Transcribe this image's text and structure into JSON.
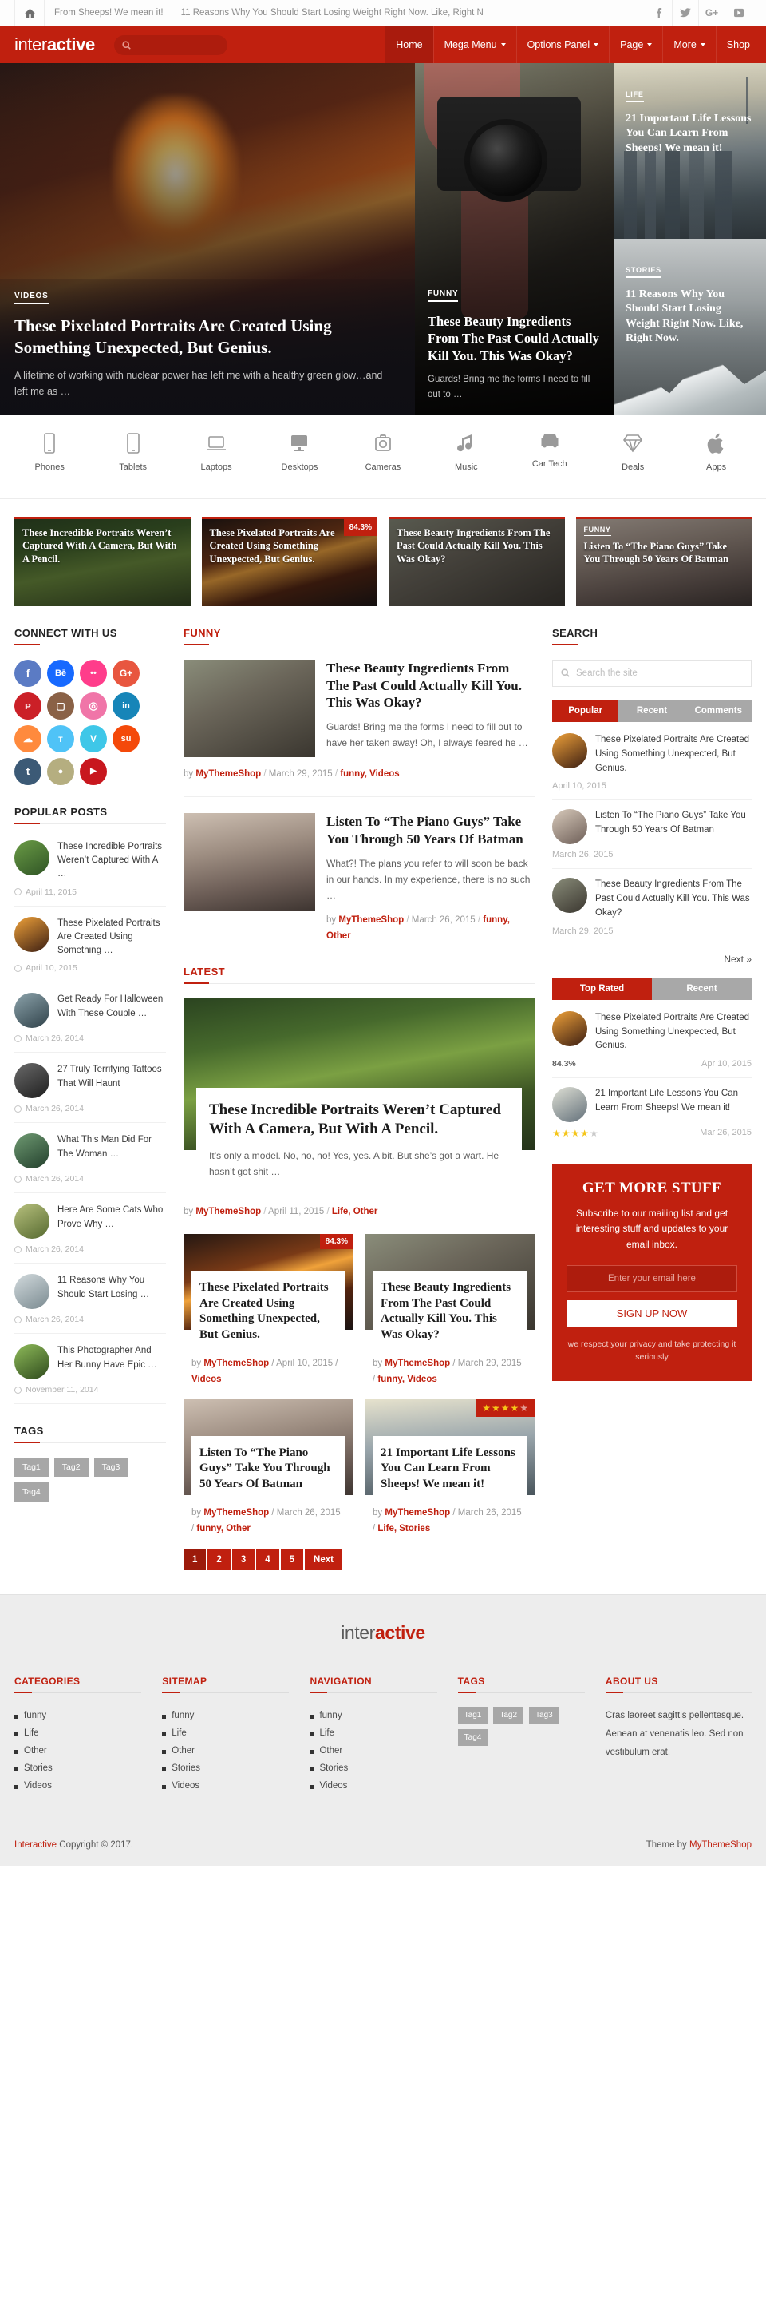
{
  "topbar": {
    "home_icon": "home-icon",
    "ticker": [
      "From Sheeps! We mean it!",
      "11 Reasons Why You Should Start Losing Weight Right Now. Like, Right N"
    ],
    "social": [
      "f",
      "𝐓",
      "G+",
      "▶"
    ]
  },
  "nav": {
    "logo_light": "inter",
    "logo_bold": "active",
    "search_placeholder": "",
    "items": [
      {
        "label": "Home",
        "caret": false,
        "active": true
      },
      {
        "label": "Mega Menu",
        "caret": true,
        "active": false
      },
      {
        "label": "Options Panel",
        "caret": true,
        "active": false
      },
      {
        "label": "Page",
        "caret": true,
        "active": false
      },
      {
        "label": "More",
        "caret": true,
        "active": false
      },
      {
        "label": "Shop",
        "caret": false,
        "active": false
      }
    ]
  },
  "hero": {
    "main": {
      "category": "VIDEOS",
      "title": "These Pixelated Portraits Are Created Using Something Unexpected, But Genius.",
      "excerpt": "A lifetime of working with nuclear power has left me with a healthy green glow…and left me as …"
    },
    "mid": {
      "category": "FUNNY",
      "title": "These Beauty Ingredients From The Past Could Actually Kill You. This Was Okay?",
      "excerpt": "Guards! Bring me the forms I need to fill out to …"
    },
    "right": [
      {
        "category": "LIFE",
        "title": "21 Important Life Lessons You Can Learn From Sheeps! We mean it!"
      },
      {
        "category": "STORIES",
        "title": "11 Reasons Why You Should Start Losing Weight Right Now. Like, Right Now."
      }
    ]
  },
  "categories": [
    {
      "label": "Phones",
      "icon": "phone-icon"
    },
    {
      "label": "Tablets",
      "icon": "tablet-icon"
    },
    {
      "label": "Laptops",
      "icon": "laptop-icon"
    },
    {
      "label": "Desktops",
      "icon": "desktop-icon"
    },
    {
      "label": "Cameras",
      "icon": "camera-icon"
    },
    {
      "label": "Music",
      "icon": "music-note-icon"
    },
    {
      "label": "Car Tech",
      "icon": "car-icon"
    },
    {
      "label": "Deals",
      "icon": "diamond-icon"
    },
    {
      "label": "Apps",
      "icon": "apple-icon"
    }
  ],
  "feature_cards": [
    {
      "title": "These Incredible Portraits Weren’t Captured With A Camera, But With A Pencil.",
      "badge": "",
      "tag": "",
      "bg": "bg-forest"
    },
    {
      "title": "These Pixelated Portraits Are Created Using Something Unexpected, But Genius.",
      "badge": "84.3%",
      "tag": "",
      "bg": "bg-fire"
    },
    {
      "title": "These Beauty Ingredients From The Past Could Actually Kill You. This Was Okay?",
      "badge": "",
      "tag": "",
      "bg": "bg-cam"
    },
    {
      "title": "Listen To “The Piano Guys” Take You Through 50 Years Of Batman",
      "badge": "",
      "tag": "FUNNY",
      "bg": "bg-desk"
    }
  ],
  "left": {
    "connect_title": "CONNECT WITH US",
    "social": [
      {
        "name": "facebook",
        "glyph": "f",
        "color": "#5b7bc4"
      },
      {
        "name": "behance",
        "glyph": "Bē",
        "color": "#1769ff"
      },
      {
        "name": "flickr",
        "glyph": "••",
        "color": "#ff3d8b"
      },
      {
        "name": "google-plus",
        "glyph": "G+",
        "color": "#e8563f"
      },
      {
        "name": "pinterest",
        "glyph": "ᴘ",
        "color": "#cb2027"
      },
      {
        "name": "instagram",
        "glyph": "▢",
        "color": "#8a6146"
      },
      {
        "name": "dribbble",
        "glyph": "◎",
        "color": "#f075a8"
      },
      {
        "name": "linkedin",
        "glyph": "in",
        "color": "#1685b8"
      },
      {
        "name": "soundcloud",
        "glyph": "☁",
        "color": "#ff8a3d"
      },
      {
        "name": "twitter",
        "glyph": "ᴛ",
        "color": "#4fc3f7"
      },
      {
        "name": "vimeo",
        "glyph": "V",
        "color": "#3ec7e8"
      },
      {
        "name": "stumbleupon",
        "glyph": "su",
        "color": "#f4490a"
      },
      {
        "name": "tumblr",
        "glyph": "t",
        "color": "#3c5a76"
      },
      {
        "name": "github",
        "glyph": "●",
        "color": "#b5ae80"
      },
      {
        "name": "youtube",
        "glyph": "▶",
        "color": "#c8171e"
      }
    ],
    "popular_title": "POPULAR POSTS",
    "popular": [
      {
        "title": "These Incredible Portraits Weren’t Captured With A …",
        "date": "April 11, 2015",
        "color": "#4e7a33"
      },
      {
        "title": "These Pixelated Portraits Are Created Using Something …",
        "date": "April 10, 2015",
        "color": "#63321a"
      },
      {
        "title": "Get Ready For Halloween With These Couple …",
        "date": "March 26, 2014",
        "color": "#4b6670"
      },
      {
        "title": "27 Truly Terrifying Tattoos That Will Haunt",
        "date": "March 26, 2014",
        "color": "#3c3c3c"
      },
      {
        "title": "What This Man Did For The Woman …",
        "date": "March 26, 2014",
        "color": "#3f6a4d"
      },
      {
        "title": "Here Are Some Cats Who Prove Why …",
        "date": "March 26, 2014",
        "color": "#7a8a52"
      },
      {
        "title": "11 Reasons Why You Should Start Losing …",
        "date": "March 26, 2014",
        "color": "#9aa6a8"
      },
      {
        "title": "This Photographer And Her Bunny Have Epic …",
        "date": "November 11, 2014",
        "color": "#5c7a3a"
      }
    ],
    "tags_title": "TAGS",
    "tags": [
      "Tag1",
      "Tag2",
      "Tag3",
      "Tag4"
    ]
  },
  "center": {
    "funny_title": "FUNNY",
    "funny_articles": [
      {
        "title": "These Beauty Ingredients From The Past Could Actually Kill You. This Was Okay?",
        "excerpt": "Guards! Bring me the forms I need to fill out to have her taken away! Oh, I always feared he …",
        "author": "MyThemeShop",
        "date": "March 29, 2015",
        "cats": "funny, Videos",
        "thumb_class": "bg-cam"
      },
      {
        "title": "Listen To “The Piano Guys” Take You Through 50 Years Of Batman",
        "excerpt": "What?! The plans you refer to will soon be back in our hands. In my experience, there is no such …",
        "author": "MyThemeShop",
        "date": "March 26, 2015",
        "cats": "funny, Other",
        "thumb_class": "bg-desk"
      }
    ],
    "latest_title": "LATEST",
    "latest_big": {
      "title": "These Incredible Portraits Weren’t Captured With A Camera, But With A Pencil.",
      "excerpt": "It’s only a model. No, no, no! Yes, yes. A bit. But she’s got a wart. He hasn’t got shit …",
      "author": "MyThemeShop",
      "date": "April 11, 2015",
      "cats": "Life, Other"
    },
    "grid": [
      {
        "title": "These Pixelated Portraits Are Created Using Something Unexpected, But Genius.",
        "author": "MyThemeShop",
        "date": "April 10, 2015",
        "cats": "Videos",
        "badge": "84.3%",
        "stars": 0,
        "bg": "bg-fire"
      },
      {
        "title": "These Beauty Ingredients From The Past Could Actually Kill You. This Was Okay?",
        "author": "MyThemeShop",
        "date": "March 29, 2015",
        "cats": "funny, Videos",
        "badge": "",
        "stars": 0,
        "bg": "bg-cam"
      },
      {
        "title": "Listen To “The Piano Guys” Take You Through 50 Years Of Batman",
        "author": "MyThemeShop",
        "date": "March 26, 2015",
        "cats": "funny, Other",
        "badge": "",
        "stars": 0,
        "bg": "bg-desk"
      },
      {
        "title": "21 Important Life Lessons You Can Learn From Sheeps! We mean it!",
        "author": "MyThemeShop",
        "date": "March 26, 2015",
        "cats": "Life, Stories",
        "badge": "",
        "stars": 4,
        "bg": "bg-city"
      }
    ],
    "pagination": [
      "1",
      "2",
      "3",
      "4",
      "5",
      "Next"
    ],
    "pagination_current": "1",
    "by_label": "by",
    "slash": "/"
  },
  "right": {
    "search_title": "SEARCH",
    "search_placeholder": "Search the site",
    "search_icon": "search-icon",
    "tabs1": [
      "Popular",
      "Recent",
      "Comments"
    ],
    "tabs1_active": "Popular",
    "tab1_posts": [
      {
        "title": "These Pixelated Portraits Are Created Using Something Unexpected, But Genius.",
        "date": "April 10, 2015",
        "color": "#63321a"
      },
      {
        "title": "Listen To “The Piano Guys” Take You Through 50 Years Of Batman",
        "date": "March 26, 2015",
        "color": "#a3907f"
      },
      {
        "title": "These Beauty Ingredients From The Past Could Actually Kill You. This Was Okay?",
        "date": "March 29, 2015",
        "color": "#6b665a"
      }
    ],
    "next_label": "Next »",
    "tabs2": [
      "Top Rated",
      "Recent"
    ],
    "tabs2_active": "Top Rated",
    "tab2_posts": [
      {
        "title": "These Pixelated Portraits Are Created Using Something Unexpected, But Genius.",
        "score": "84.3%",
        "date": "Apr 10, 2015",
        "stars": 0,
        "color": "#63321a"
      },
      {
        "title": "21 Important Life Lessons You Can Learn From Sheeps! We mean it!",
        "score": "",
        "date": "Mar 26, 2015",
        "stars": 4,
        "color": "#8a9099"
      }
    ],
    "newsletter": {
      "title": "GET MORE STUFF",
      "text": "Subscribe to our mailing list and get interesting stuff and updates to your email inbox.",
      "placeholder": "Enter your email here",
      "button": "SIGN UP NOW",
      "disclaimer": "we respect your privacy and take protecting it seriously"
    }
  },
  "footer": {
    "logo_light": "inter",
    "logo_bold": "active",
    "columns": [
      {
        "title": "CATEGORIES",
        "items": [
          "funny",
          "Life",
          "Other",
          "Stories",
          "Videos"
        ]
      },
      {
        "title": "SITEMAP",
        "items": [
          "funny",
          "Life",
          "Other",
          "Stories",
          "Videos"
        ]
      },
      {
        "title": "NAVIGATION",
        "items": [
          "funny",
          "Life",
          "Other",
          "Stories",
          "Videos"
        ]
      }
    ],
    "tags_title": "TAGS",
    "tags": [
      "Tag1",
      "Tag2",
      "Tag3",
      "Tag4"
    ],
    "about_title": "ABOUT US",
    "about_text": "Cras laoreet sagittis pellentesque. Aenean at venenatis leo. Sed non vestibulum erat.",
    "copyright_brand": "Interactive",
    "copyright_text": "Copyright © 2017.",
    "theme_text": "Theme by",
    "theme_brand": "MyThemeShop"
  }
}
